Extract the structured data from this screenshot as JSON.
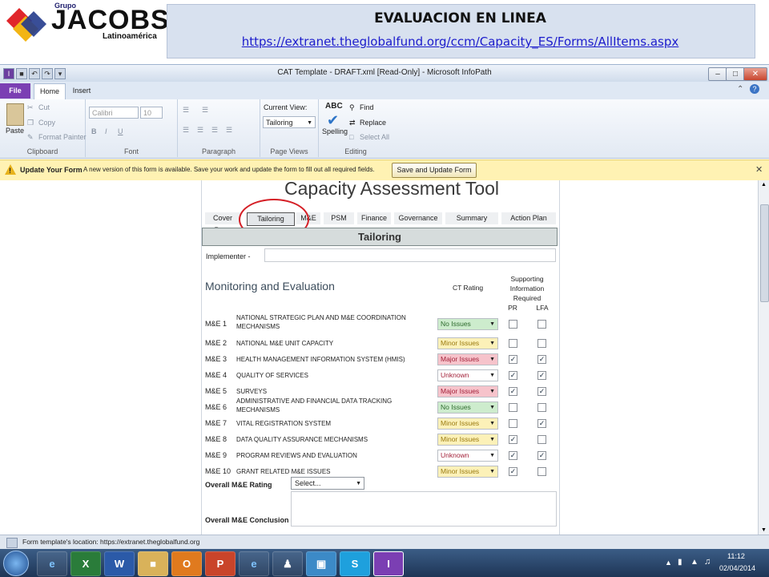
{
  "slide": {
    "logo": {
      "grupo": "Grupo",
      "name": "JACOBS",
      "region": "Latinoamérica"
    },
    "title": "EVALUACION EN LINEA",
    "url": "https://extranet.theglobalfund.org/ccm/Capacity_ES/Forms/AllItems.aspx"
  },
  "window": {
    "title": "CAT Template - DRAFT.xml [Read-Only] - Microsoft InfoPath",
    "tabs": {
      "file": "File",
      "home": "Home",
      "insert": "Insert"
    }
  },
  "ribbon": {
    "clipboard": {
      "paste": "Paste",
      "cut": "Cut",
      "copy": "Copy",
      "format_painter": "Format Painter",
      "label": "Clipboard"
    },
    "font": {
      "family": "Calibri",
      "size": "10",
      "bold": "B",
      "italic": "I",
      "underline": "U",
      "label": "Font"
    },
    "paragraph": {
      "label": "Paragraph"
    },
    "views": {
      "current_view": "Current View:",
      "view_value": "Tailoring",
      "label": "Page Views"
    },
    "editing": {
      "spelling": "Spelling",
      "find": "Find",
      "replace": "Replace",
      "select_all": "Select All",
      "label": "Editing"
    }
  },
  "message_bar": {
    "title": "Update Your Form",
    "text": "A new version of this form is available. Save your work and update the form to fill out all required fields.",
    "button": "Save and Update Form"
  },
  "form": {
    "title": "Capacity Assessment Tool",
    "tabs": [
      "Cover Page",
      "Tailoring",
      "M&E",
      "PSM",
      "Finance",
      "Governance",
      "Summary",
      "Action Plan"
    ],
    "section_title": "Tailoring",
    "implementer_label": "Implementer -",
    "implementer_value": "",
    "section_heading": "Monitoring and Evaluation",
    "col_ct_rating": "CT Rating",
    "col_supporting": "Supporting Information Required",
    "col_pr": "PR",
    "col_lfa": "LFA",
    "rows": [
      {
        "code": "M&E 1",
        "name": "NATIONAL STRATEGIC PLAN AND M&E COORDINATION MECHANISMS",
        "rating": "No Issues",
        "pr": false,
        "lfa": false
      },
      {
        "code": "M&E 2",
        "name": "NATIONAL M&E UNIT CAPACITY",
        "rating": "Minor Issues",
        "pr": false,
        "lfa": false
      },
      {
        "code": "M&E 3",
        "name": "HEALTH MANAGEMENT INFORMATION SYSTEM (HMIS)",
        "rating": "Major Issues",
        "pr": true,
        "lfa": true
      },
      {
        "code": "M&E 4",
        "name": "QUALITY OF SERVICES",
        "rating": "Unknown",
        "pr": true,
        "lfa": true
      },
      {
        "code": "M&E 5",
        "name": "SURVEYS",
        "rating": "Major Issues",
        "pr": true,
        "lfa": true
      },
      {
        "code": "M&E 6",
        "name": "ADMINISTRATIVE AND FINANCIAL DATA TRACKING MECHANISMS",
        "rating": "No Issues",
        "pr": false,
        "lfa": false
      },
      {
        "code": "M&E 7",
        "name": "VITAL REGISTRATION SYSTEM",
        "rating": "Minor Issues",
        "pr": false,
        "lfa": true
      },
      {
        "code": "M&E 8",
        "name": "DATA QUALITY ASSURANCE MECHANISMS",
        "rating": "Minor Issues",
        "pr": true,
        "lfa": false
      },
      {
        "code": "M&E 9",
        "name": "PROGRAM REVIEWS AND EVALUATION",
        "rating": "Unknown",
        "pr": true,
        "lfa": true
      },
      {
        "code": "M&E 10",
        "name": "GRANT RELATED M&E ISSUES",
        "rating": "Minor Issues",
        "pr": true,
        "lfa": false
      }
    ],
    "rating_colors": {
      "No Issues": "#cdeccd",
      "Minor Issues": "#fcf1b8",
      "Major Issues": "#f6c3cb",
      "Unknown": "#ffffff"
    },
    "rating_text_colors": {
      "No Issues": "#2e6b2e",
      "Minor Issues": "#9a7a10",
      "Major Issues": "#a3223a",
      "Unknown": "#a3223a"
    },
    "overall_label": "Overall M&E Rating",
    "overall_value": "Select...",
    "conclusion_label": "Overall M&E Conclusion"
  },
  "status_bar": {
    "text": "Form template's location: https://extranet.theglobalfund.org"
  },
  "taskbar": {
    "time": "11:12",
    "date": "02/04/2014"
  }
}
